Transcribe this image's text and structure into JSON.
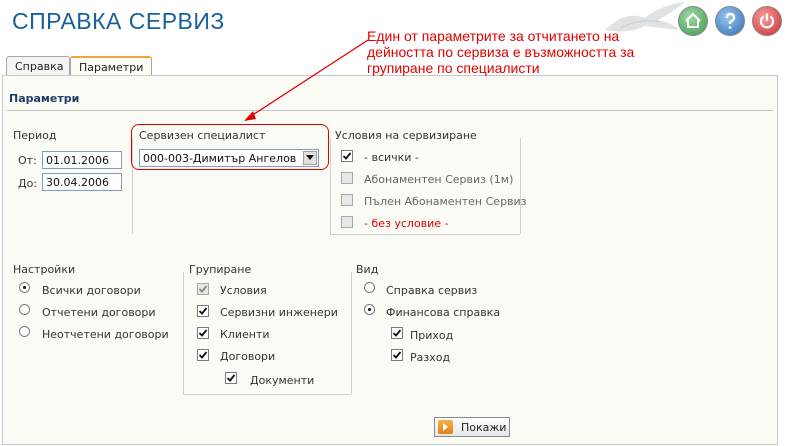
{
  "header": {
    "title": "СПРАВКА СЕРВИЗ",
    "buttons": [
      {
        "icon": "home-icon"
      },
      {
        "icon": "help-icon"
      },
      {
        "icon": "power-icon"
      }
    ]
  },
  "annotation": {
    "text": "Един от параметрите за отчитането на дейността по сервиза е възможността за групиране по специалисти",
    "color": "#e00000"
  },
  "tabs": [
    {
      "label": "Справка",
      "active": false
    },
    {
      "label": "Параметри",
      "active": true
    }
  ],
  "panel": {
    "title": "Параметри",
    "period": {
      "label": "Период",
      "from_label": "От:",
      "from_value": "01.01.2006",
      "to_label": "До:",
      "to_value": "30.04.2006"
    },
    "specialist": {
      "label": "Сервизен специалист",
      "selected": "000-003-Димитър Ангелов"
    },
    "conditions": {
      "label": "Условия на сервизиране",
      "items": [
        {
          "label": "- всички -",
          "checked": true,
          "enabled": true
        },
        {
          "label": "Абонаментен Сервиз (1м)",
          "checked": false,
          "enabled": false
        },
        {
          "label": "Пълен Абонаментен Сервиз",
          "checked": false,
          "enabled": false
        },
        {
          "label": "- без условие -",
          "checked": false,
          "enabled": false
        }
      ]
    },
    "settings": {
      "label": "Настройки",
      "items": [
        {
          "label": "Всички договори",
          "selected": true
        },
        {
          "label": "Отчетени договори",
          "selected": false
        },
        {
          "label": "Неотчетени договори",
          "selected": false
        }
      ]
    },
    "grouping": {
      "label": "Групиране",
      "items": [
        {
          "label": "Условия",
          "checked": true,
          "enabled": false
        },
        {
          "label": "Сервизни инженери",
          "checked": true,
          "enabled": true
        },
        {
          "label": "Клиенти",
          "checked": true,
          "enabled": true
        },
        {
          "label": "Договори",
          "checked": true,
          "enabled": true
        },
        {
          "label": "Документи",
          "checked": true,
          "enabled": true
        }
      ]
    },
    "view": {
      "label": "Вид",
      "items": [
        {
          "label": "Справка сервиз",
          "selected": false
        },
        {
          "label": "Финансова справка",
          "selected": true
        }
      ],
      "sub_items": [
        {
          "label": "Приход",
          "checked": true
        },
        {
          "label": "Разход",
          "checked": true
        }
      ]
    },
    "show_button": "Покажи"
  }
}
